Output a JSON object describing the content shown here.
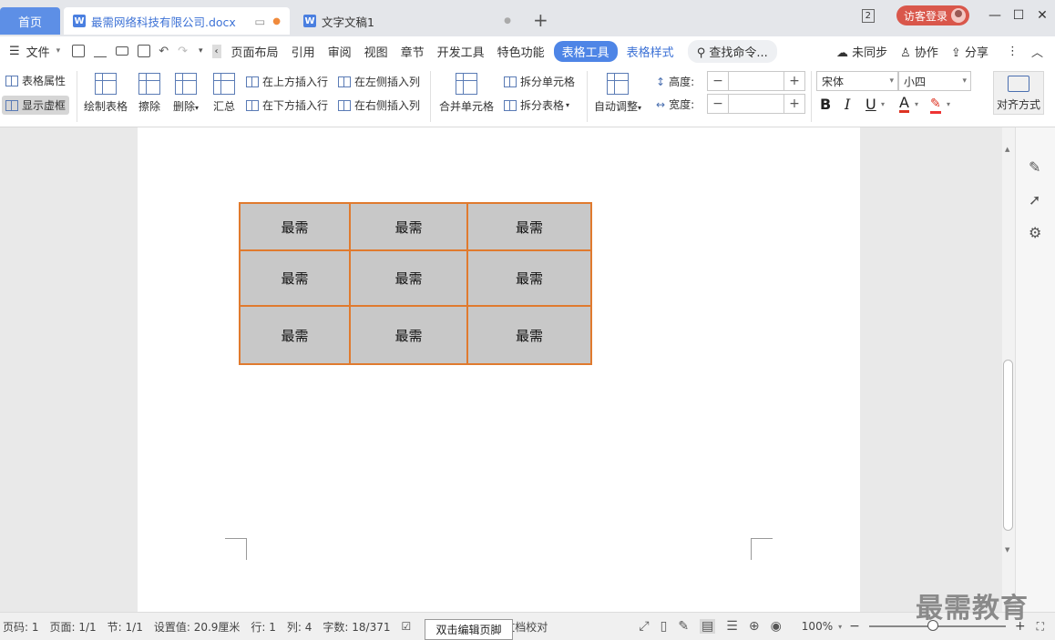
{
  "tabs": {
    "home": "首页",
    "doc1": "最需网络科技有限公司.docx",
    "doc2": "文字文稿1",
    "add": "+"
  },
  "titlebar": {
    "badge": "2",
    "login": "访客登录",
    "minimize": "—",
    "restore": "☐",
    "close": "✕"
  },
  "menu": {
    "file": "文件",
    "items": [
      "页面布局",
      "引用",
      "审阅",
      "视图",
      "章节",
      "开发工具",
      "特色功能"
    ],
    "active": "表格工具",
    "style": "表格样式",
    "search": "查找命令...",
    "sync": "未同步",
    "collab": "协作",
    "share": "分享"
  },
  "ribbon": {
    "table_props": "表格属性",
    "show_gridlines": "显示虚框",
    "draw_table": "绘制表格",
    "erase": "擦除",
    "delete": "删除",
    "summary": "汇总",
    "insert_above": "在上方插入行",
    "insert_below": "在下方插入行",
    "insert_left": "在左侧插入列",
    "insert_right": "在右侧插入列",
    "merge": "合并单元格",
    "split_cell": "拆分单元格",
    "split_table": "拆分表格",
    "autofit": "自动调整",
    "height": "高度:",
    "width": "宽度:",
    "font": "宋体",
    "size": "小四",
    "bold": "B",
    "italic": "I",
    "underline": "U",
    "font_color": "A",
    "align": "对齐方式"
  },
  "table": {
    "rows": [
      [
        "最需",
        "最需",
        "最需"
      ],
      [
        "最需",
        "最需",
        "最需"
      ],
      [
        "最需",
        "最需",
        "最需"
      ]
    ]
  },
  "status": {
    "page_no": "页码: 1",
    "pages": "页面: 1/1",
    "section": "节: 1/1",
    "setting": "设置值: 20.9厘米",
    "row": "行: 1",
    "col": "列: 4",
    "words": "字数: 18/371",
    "proof": "文档校对",
    "zoom": "100%",
    "tooltip": "双击编辑页脚"
  },
  "watermark": "最需教育",
  "colors": {
    "accent": "#4e85e6",
    "table_border": "#e07a2e",
    "cell_fill": "#c8c8c8",
    "login": "#d9574b"
  }
}
